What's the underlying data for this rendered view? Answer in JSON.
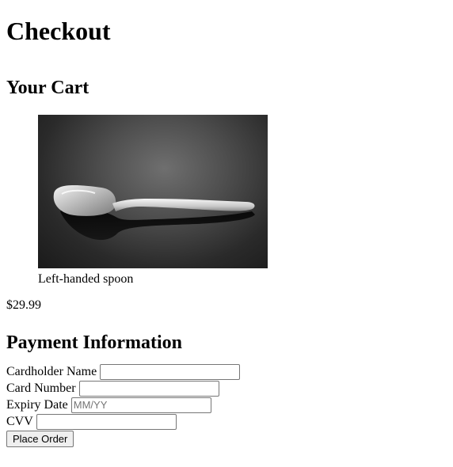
{
  "page": {
    "title": "Checkout"
  },
  "cart": {
    "heading": "Your Cart",
    "item": {
      "image_subject": "spoon-photo",
      "caption": "Left-handed spoon",
      "price": "$29.99"
    }
  },
  "payment": {
    "heading": "Payment Information",
    "fields": {
      "cardholder_name": {
        "label": "Cardholder Name",
        "value": "",
        "placeholder": ""
      },
      "card_number": {
        "label": "Card Number",
        "value": "",
        "placeholder": ""
      },
      "expiry_date": {
        "label": "Expiry Date",
        "value": "",
        "placeholder": "MM/YY"
      },
      "cvv": {
        "label": "CVV",
        "value": "",
        "placeholder": ""
      }
    },
    "submit_label": "Place Order"
  }
}
